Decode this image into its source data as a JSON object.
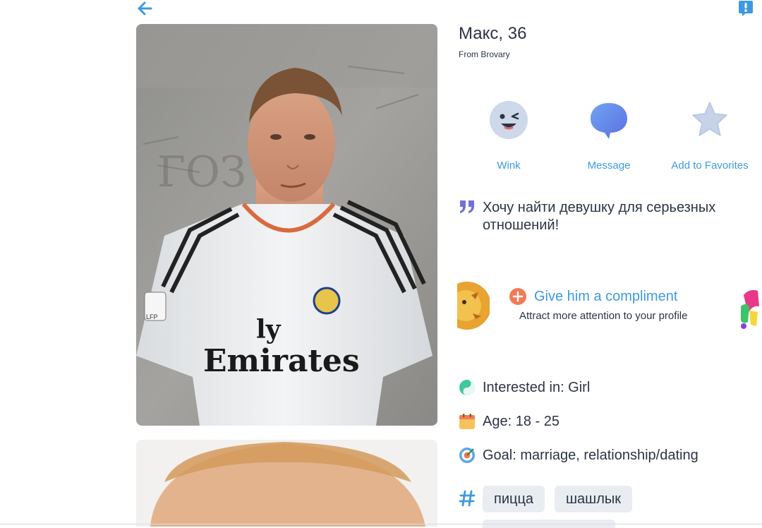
{
  "profile": {
    "name_age": "Макс, 36",
    "from": "From Brovary",
    "about": "Хочу найти девушку для серьезных отношений!"
  },
  "actions": {
    "wink": "Wink",
    "message": "Message",
    "favorites": "Add to Favorites"
  },
  "compliment": {
    "title": "Give him a compliment",
    "subtitle": "Attract more attention to your profile"
  },
  "details": {
    "interested_in": "Interested in: Girl",
    "age": "Age: 18 - 25",
    "goal": "Goal: marriage, relationship/dating"
  },
  "interests": [
    "пицца",
    "шашлык"
  ],
  "photo_text": {
    "shirt_line1": "ly",
    "shirt_line2": "Emirates",
    "patch": "LFP"
  },
  "colors": {
    "accent": "#3d9ae0",
    "tag_bg": "#e9edf2",
    "compliment_plus": "#f07c55",
    "icon_purple": "#6e72d8"
  }
}
